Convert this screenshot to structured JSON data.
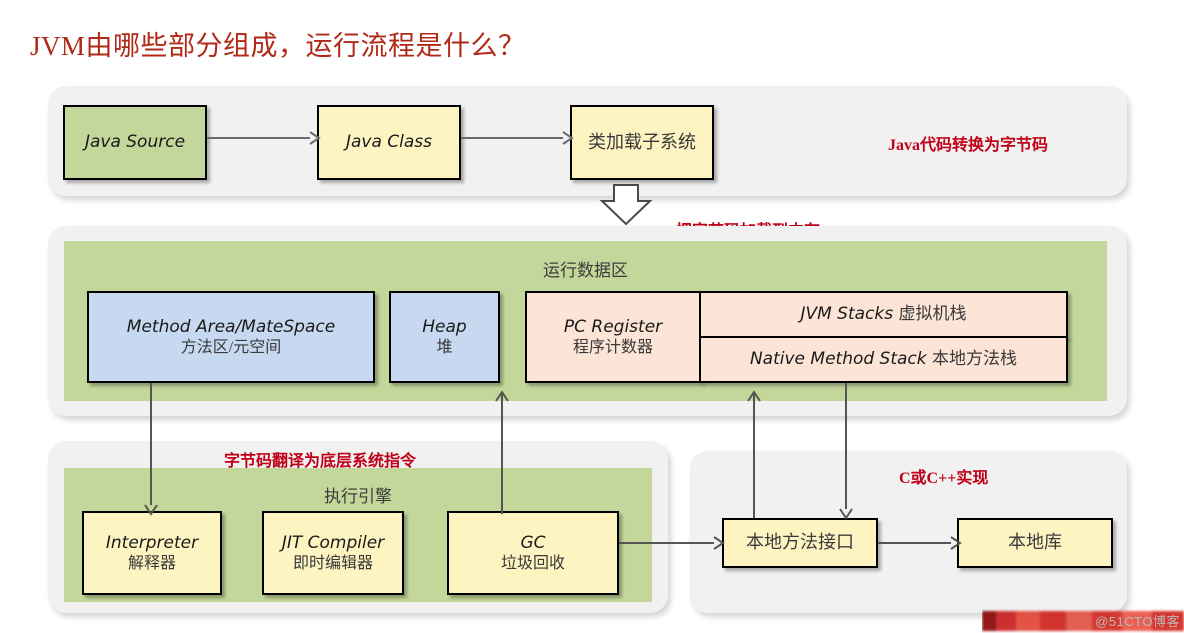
{
  "page": {
    "title": "JVM由哪些部分组成，运行流程是什么？",
    "title_color": "#b02a18",
    "background": "#ffffff"
  },
  "palette": {
    "panel_grey": "#f1f1f1",
    "green": "#c4d79b",
    "yellow": "#fdf4c2",
    "blue": "#c6d9f0",
    "peach": "#fce4d6",
    "note_red": "#c00018",
    "connector_grey": "#6b6b6b",
    "border_black": "#000000"
  },
  "sections": {
    "top": {
      "note": "Java代码转换为字节码",
      "boxes": [
        {
          "en": "Java Source",
          "fill": "green"
        },
        {
          "en": "Java Class",
          "fill": "yellow"
        },
        {
          "cn": "类加载子系统",
          "fill": "yellow"
        }
      ]
    },
    "runtime": {
      "note": "把字节码加载到内存",
      "caption": "运行数据区",
      "boxes": [
        {
          "en": "Method Area/MateSpace",
          "cn": "方法区/元空间",
          "fill": "blue"
        },
        {
          "en": "Heap",
          "cn": "堆",
          "fill": "blue"
        },
        {
          "en": "PC Register",
          "cn": "程序计数器",
          "fill": "peach"
        },
        {
          "en": "JVM Stacks",
          "cn": "虚拟机栈",
          "fill": "peach"
        },
        {
          "en": "Native Method Stack",
          "cn": "本地方法栈",
          "fill": "peach"
        }
      ]
    },
    "engine": {
      "note": "字节码翻译为底层系统指令",
      "caption": "执行引擎",
      "boxes": [
        {
          "en": "Interpreter",
          "cn": "解释器",
          "fill": "yellow"
        },
        {
          "en": "JIT Compiler",
          "cn": "即时编辑器",
          "fill": "yellow"
        },
        {
          "en": "GC",
          "cn": "垃圾回收",
          "fill": "yellow"
        }
      ]
    },
    "native": {
      "note": "C或C++实现",
      "boxes": [
        {
          "cn": "本地方法接口",
          "fill": "yellow"
        },
        {
          "cn": "本地库",
          "fill": "yellow"
        }
      ]
    }
  },
  "watermark": {
    "text": "@51CTO博客"
  }
}
